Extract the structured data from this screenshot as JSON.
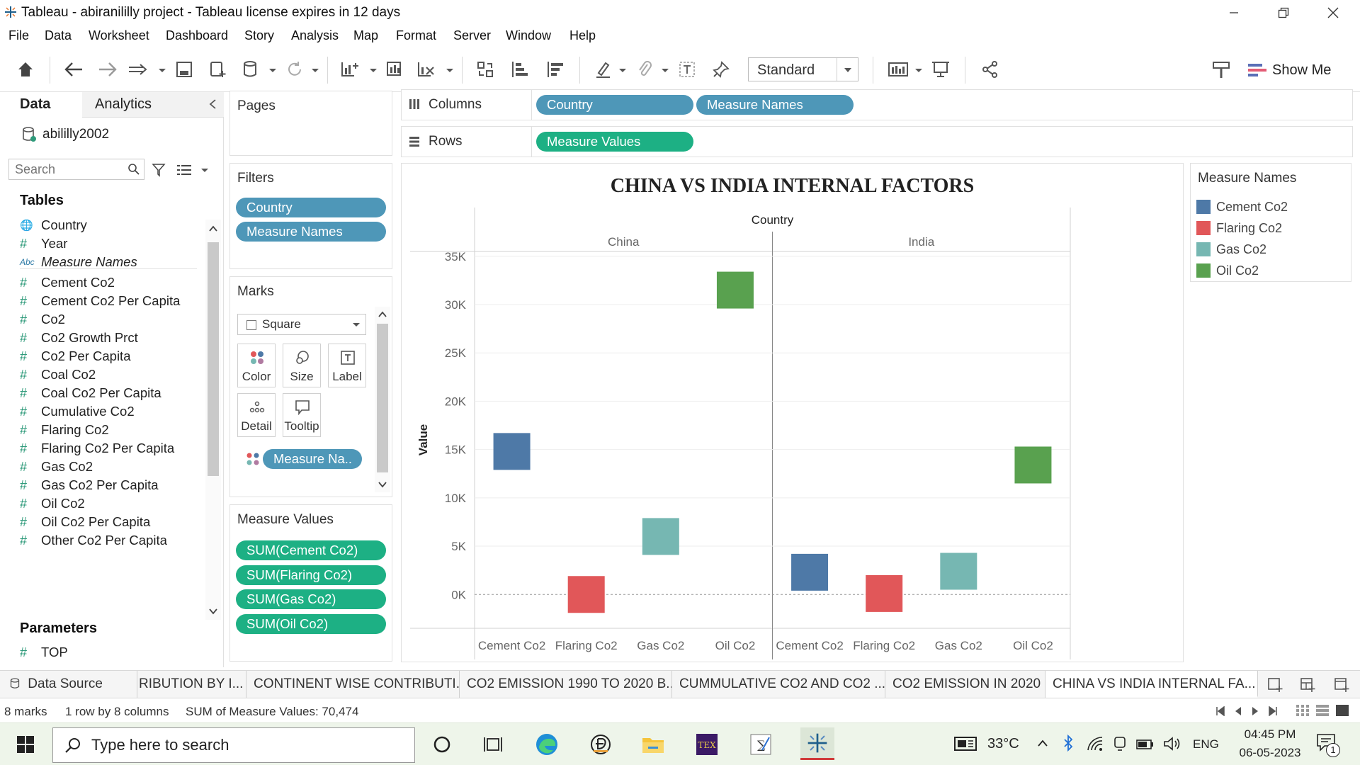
{
  "window": {
    "title": "Tableau - abiranililly project - Tableau license expires in 12 days"
  },
  "menu": [
    "File",
    "Data",
    "Worksheet",
    "Dashboard",
    "Story",
    "Analysis",
    "Map",
    "Format",
    "Server",
    "Window",
    "Help"
  ],
  "toolbar": {
    "fit_value": "Standard",
    "show_me_label": "Show Me"
  },
  "data_pane": {
    "tab_data": "Data",
    "tab_analytics": "Analytics",
    "datasource": "abililly2002",
    "search_placeholder": "Search",
    "tables_header": "Tables",
    "fields": [
      {
        "name": "Country",
        "type": "globe"
      },
      {
        "name": "Year",
        "type": "measure"
      },
      {
        "name": "Measure Names",
        "type": "abc"
      },
      {
        "name": "Cement Co2",
        "type": "measure"
      },
      {
        "name": "Cement Co2 Per Capita",
        "type": "measure"
      },
      {
        "name": "Co2",
        "type": "measure"
      },
      {
        "name": "Co2 Growth Prct",
        "type": "measure"
      },
      {
        "name": "Co2 Per Capita",
        "type": "measure"
      },
      {
        "name": "Coal Co2",
        "type": "measure"
      },
      {
        "name": "Coal Co2 Per Capita",
        "type": "measure"
      },
      {
        "name": "Cumulative Co2",
        "type": "measure"
      },
      {
        "name": "Flaring Co2",
        "type": "measure"
      },
      {
        "name": "Flaring Co2 Per Capita",
        "type": "measure"
      },
      {
        "name": "Gas Co2",
        "type": "measure"
      },
      {
        "name": "Gas Co2 Per Capita",
        "type": "measure"
      },
      {
        "name": "Oil Co2",
        "type": "measure"
      },
      {
        "name": "Oil Co2 Per Capita",
        "type": "measure"
      },
      {
        "name": "Other Co2 Per Capita",
        "type": "measure"
      }
    ],
    "parameters_header": "Parameters",
    "parameters": [
      "TOP"
    ]
  },
  "pages_card": {
    "label": "Pages"
  },
  "filters_card": {
    "label": "Filters",
    "pills": [
      "Country",
      "Measure Names"
    ]
  },
  "marks_card": {
    "label": "Marks",
    "mark_type": "Square",
    "buttons": [
      "Color",
      "Size",
      "Label",
      "Detail",
      "Tooltip"
    ],
    "color_pill": "Measure Na.."
  },
  "measure_values_card": {
    "label": "Measure Values",
    "pills": [
      "SUM(Cement Co2)",
      "SUM(Flaring Co2)",
      "SUM(Gas Co2)",
      "SUM(Oil Co2)"
    ]
  },
  "shelves": {
    "columns_label": "Columns",
    "rows_label": "Rows",
    "columns_pills": [
      "Country",
      "Measure Names"
    ],
    "rows_pills": [
      "Measure Values"
    ]
  },
  "legend": {
    "title": "Measure Names",
    "items": [
      {
        "name": "Cement Co2",
        "color": "#4e79a7"
      },
      {
        "name": "Flaring Co2",
        "color": "#e15759"
      },
      {
        "name": "Gas Co2",
        "color": "#76b7b2"
      },
      {
        "name": "Oil Co2",
        "color": "#59a14f"
      }
    ]
  },
  "chart_data": {
    "type": "scatter",
    "title": "CHINA VS INDIA INTERNAL FACTORS",
    "column_header": "Country",
    "panes": [
      "China",
      "India"
    ],
    "categories": [
      "Cement Co2",
      "Flaring Co2",
      "Gas Co2",
      "Oil Co2"
    ],
    "ylabel": "Value",
    "ylim": [
      -3500,
      35500
    ],
    "yticks": [
      0,
      5000,
      10000,
      15000,
      20000,
      25000,
      30000,
      35000
    ],
    "ytick_labels": [
      "0K",
      "5K",
      "10K",
      "15K",
      "20K",
      "25K",
      "30K",
      "35K"
    ],
    "colors": [
      "#4e79a7",
      "#e15759",
      "#76b7b2",
      "#59a14f"
    ],
    "series": [
      {
        "name": "China",
        "values": [
          14800,
          0,
          6000,
          31500
        ]
      },
      {
        "name": "India",
        "values": [
          2300,
          100,
          2400,
          13400
        ]
      }
    ]
  },
  "sheet_tabs": {
    "datasource": "Data Source",
    "tabs": [
      "RIBUTION BY I...",
      "CONTINENT WISE CONTRIBUTI...",
      "CO2 EMISSION 1990 TO 2020 B...",
      "CUMMULATIVE CO2 AND CO2 ...",
      "CO2 EMISSION IN 2020",
      "CHINA VS INDIA INTERNAL FA..."
    ]
  },
  "status": {
    "marks": "8 marks",
    "rowscols": "1 row by 8 columns",
    "sum": "SUM of Measure Values: 70,474"
  },
  "taskbar": {
    "search_placeholder": "Type here to search",
    "temperature": "33°C",
    "language": "ENG",
    "time": "04:45 PM",
    "date": "06-05-2023",
    "notification_count": "1"
  }
}
